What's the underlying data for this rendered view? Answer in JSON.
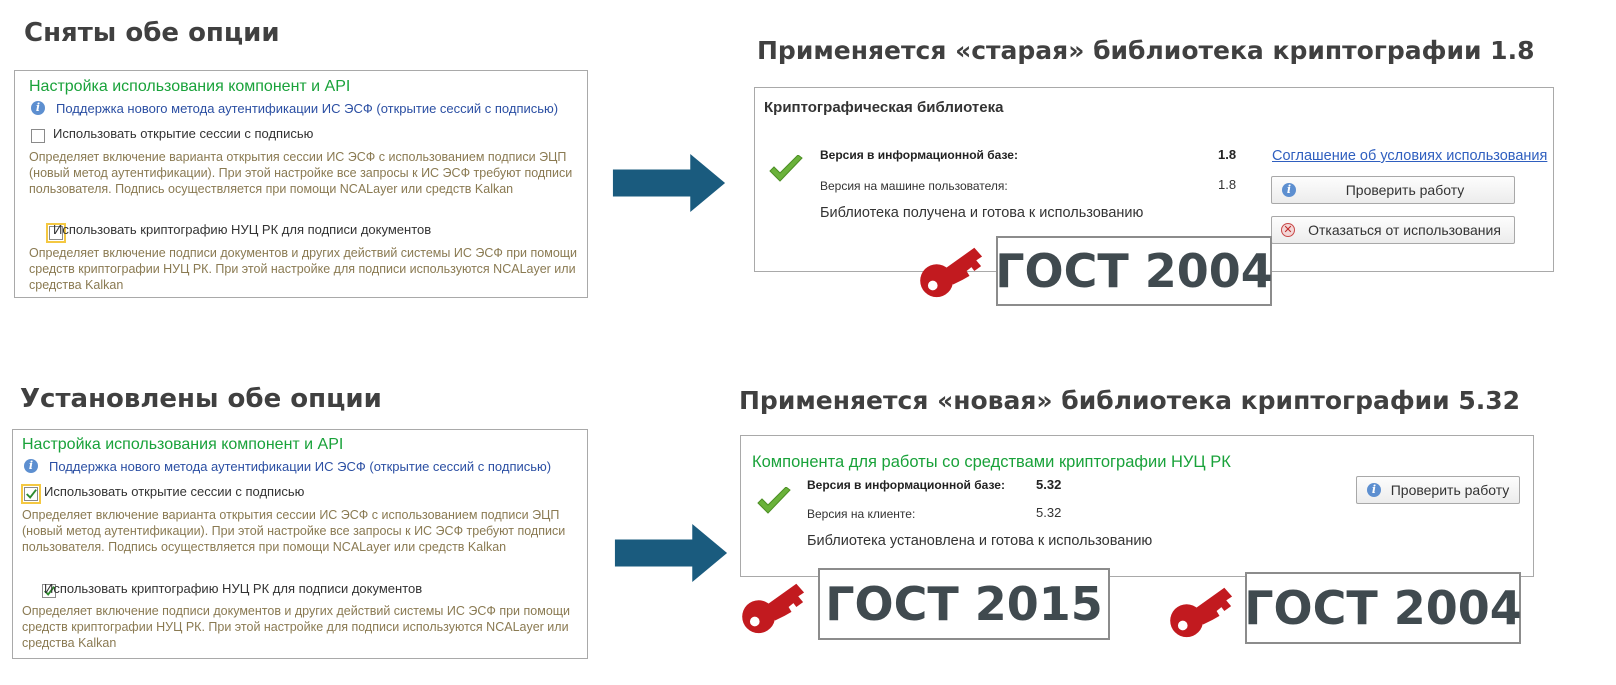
{
  "top_left": {
    "heading": "Сняты обе опции",
    "panel_title": "Настройка использования компонент и API",
    "info_link": "Поддержка нового метода аутентификации ИС ЭСФ (открытие сессий с подписью)",
    "opt1_label": "Использовать открытие сессии с подписью",
    "opt1_checked": false,
    "opt1_desc": "Определяет включение варианта открытия сессии ИС ЭСФ с использованием подписи ЭЦП (новый метод аутентификации). При этой настройке все запросы к ИС ЭСФ требуют подписи пользователя. Подпись осуществляется при помощи NCALayer или средств Kalkan",
    "opt2_label": "Использовать криптографию НУЦ РК для подписи документов",
    "opt2_checked": false,
    "opt2_desc": "Определяет включение подписи документов и других действий системы ИС ЭСФ при помощи средств криптографии НУЦ РК. При этой настройке для подписи используются NCALayer или средства Kalkan"
  },
  "top_right": {
    "heading": "Применяется «старая» библиотека криптографии 1.8",
    "panel_title": "Криптографическая библиотека",
    "db_version_label": "Версия в информационной базе:",
    "db_version": "1.8",
    "user_version_label": "Версия на машине пользователя:",
    "user_version": "1.8",
    "status": "Библиотека получена и готова к использованию",
    "agreement_link": "Соглашение об условиях использования",
    "check_button": "Проверить работу",
    "refuse_button": "Отказаться от использования",
    "gost": "ГОСТ 2004"
  },
  "bottom_left": {
    "heading": "Установлены  обе опции",
    "panel_title": "Настройка использования компонент и API",
    "info_link": "Поддержка нового метода аутентификации ИС ЭСФ (открытие сессий с подписью)",
    "opt1_label": "Использовать открытие сессии с подписью",
    "opt1_checked": true,
    "opt1_desc": "Определяет включение варианта открытия сессии ИС ЭСФ с использованием подписи ЭЦП (новый метод аутентификации). При этой настройке все запросы к ИС ЭСФ требуют подписи пользователя. Подпись осуществляется при помощи NCALayer или средств Kalkan",
    "opt2_label": "Использовать криптографию НУЦ РК для подписи документов",
    "opt2_checked": true,
    "opt2_desc": "Определяет включение подписи документов и других действий системы ИС ЭСФ при помощи средств криптографии НУЦ РК. При этой настройке для подписи используются NCALayer или средства Kalkan"
  },
  "bottom_right": {
    "heading": "Применяется «новая» библиотека криптографии 5.32",
    "panel_title": "Компонента для работы со средствами криптографии НУЦ РК",
    "db_version_label": "Версия в информационной базе:",
    "db_version": "5.32",
    "client_version_label": "Версия на клиенте:",
    "client_version": "5.32",
    "status": "Библиотека установлена и готова к использованию",
    "check_button": "Проверить работу",
    "gost_a": "ГОСТ 2015",
    "gost_b": "ГОСТ 2004"
  },
  "colors": {
    "arrow": "#1a5b7e",
    "key": "#c21a1f",
    "check_green": "#6ab23a",
    "title_green": "#19a23a"
  }
}
